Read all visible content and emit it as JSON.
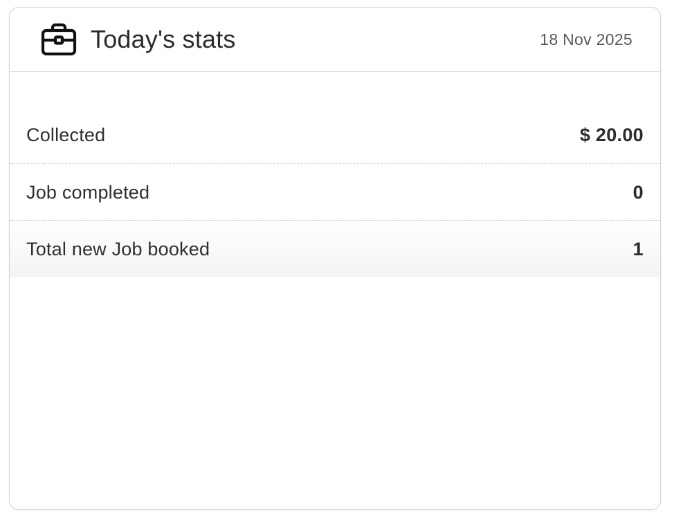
{
  "card": {
    "icon": "briefcase-icon",
    "title": "Today's stats",
    "date": "18 Nov 2025"
  },
  "stats": [
    {
      "label": "Collected",
      "value": "$ 20.00"
    },
    {
      "label": "Job completed",
      "value": "0"
    },
    {
      "label": "Total new Job booked",
      "value": "1"
    }
  ]
}
